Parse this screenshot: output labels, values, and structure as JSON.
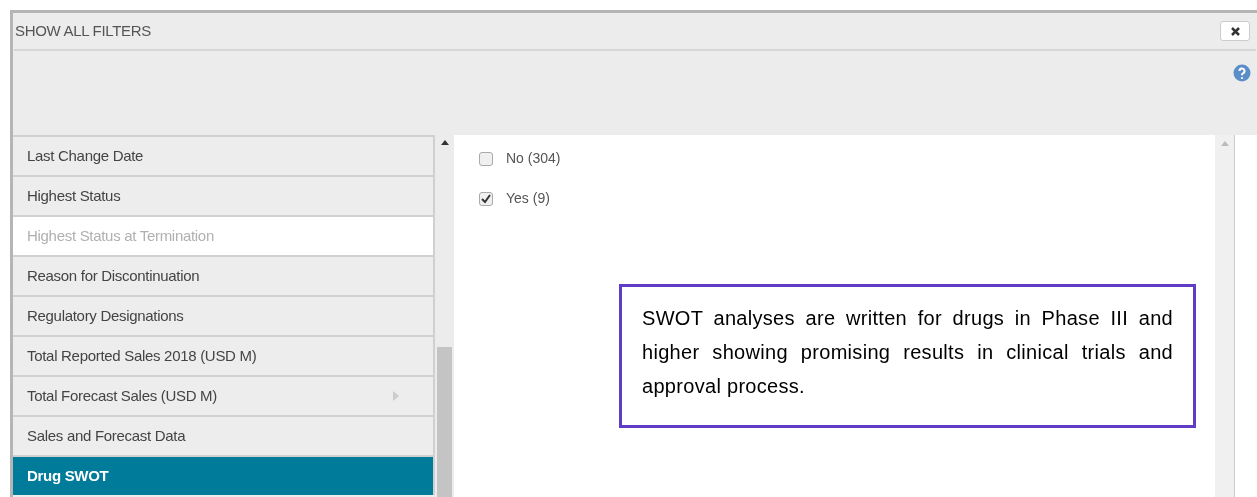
{
  "dialog": {
    "title": "SHOW ALL FILTERS"
  },
  "filters": [
    {
      "label": "Last Change Date",
      "selected": false,
      "disabled": false,
      "has_submenu": false
    },
    {
      "label": "Highest Status",
      "selected": false,
      "disabled": false,
      "has_submenu": false
    },
    {
      "label": "Highest Status at Termination",
      "selected": false,
      "disabled": true,
      "has_submenu": false
    },
    {
      "label": "Reason for Discontinuation",
      "selected": false,
      "disabled": false,
      "has_submenu": false
    },
    {
      "label": "Regulatory Designations",
      "selected": false,
      "disabled": false,
      "has_submenu": false
    },
    {
      "label": "Total Reported Sales 2018 (USD M)",
      "selected": false,
      "disabled": false,
      "has_submenu": false
    },
    {
      "label": "Total Forecast Sales (USD M)",
      "selected": false,
      "disabled": false,
      "has_submenu": true
    },
    {
      "label": "Sales and Forecast Data",
      "selected": false,
      "disabled": false,
      "has_submenu": false
    },
    {
      "label": "Drug SWOT",
      "selected": true,
      "disabled": false,
      "has_submenu": false
    }
  ],
  "options": [
    {
      "label": "No (304)",
      "checked": false
    },
    {
      "label": "Yes (9)",
      "checked": true
    }
  ],
  "callout": {
    "text": "SWOT analyses are written for drugs in Phase III and higher showing promising results in clinical trials and approval process."
  }
}
